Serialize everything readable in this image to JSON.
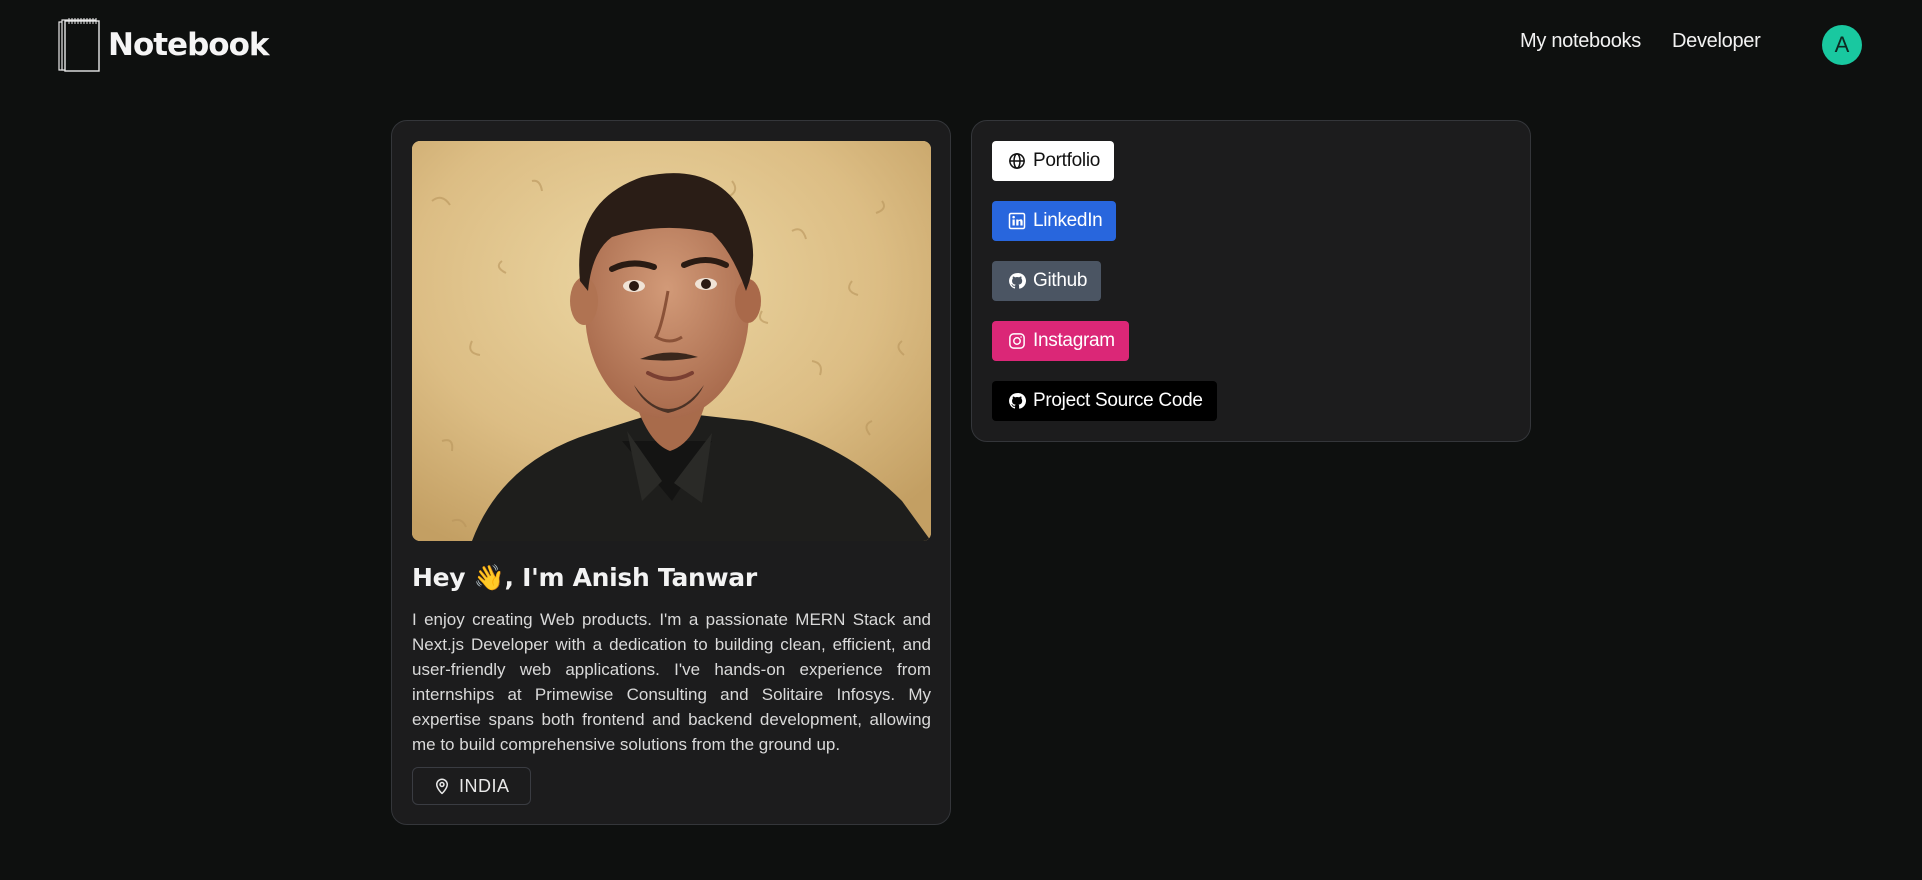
{
  "header": {
    "brand": "Notebook",
    "nav": {
      "my_notebooks": "My notebooks",
      "developer": "Developer"
    },
    "avatar_initial": "A"
  },
  "profile": {
    "photo_alt": "Anish Tanwar",
    "greeting": "Hey 👋, I'm Anish Tanwar",
    "bio": "I enjoy creating Web products. I'm a passionate MERN Stack and Next.js Developer with a dedication to building clean, efficient, and user-friendly web applications. I've hands-on experience from internships at Primewise Consulting and Solitaire Infosys. My expertise spans both frontend and backend development, allowing me to build comprehensive solutions from the ground up.",
    "location": "INDIA"
  },
  "links": {
    "portfolio": "Portfolio",
    "linkedin": "LinkedIn",
    "github": "Github",
    "instagram": "Instagram",
    "source_code": "Project Source Code"
  },
  "colors": {
    "background": "#0e100f",
    "card": "#1c1c1d",
    "avatar": "#19c8a0",
    "linkedin": "#2866dd",
    "github": "#4b5563",
    "instagram": "#db2777",
    "source_code": "#000000",
    "portfolio": "#ffffff"
  },
  "icons": {
    "brand": "notebook-icon",
    "portfolio": "globe-icon",
    "linkedin": "linkedin-icon",
    "github": "github-icon",
    "instagram": "instagram-icon",
    "source_code": "github-icon",
    "location": "map-pin-icon"
  }
}
